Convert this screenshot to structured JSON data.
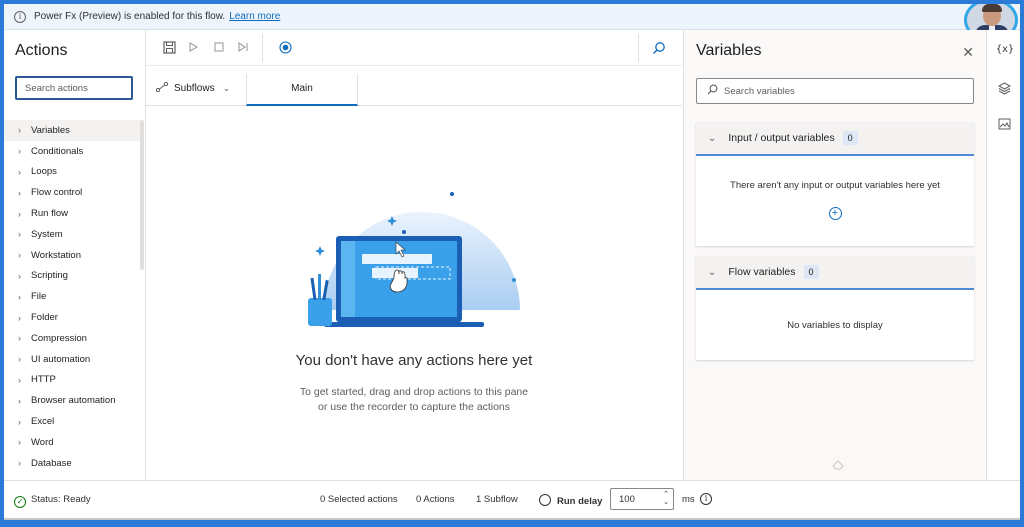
{
  "banner": {
    "text": "Power Fx (Preview) is enabled for this flow.",
    "link": "Learn more"
  },
  "actions_pane": {
    "title": "Actions",
    "search_placeholder": "Search actions",
    "items": [
      {
        "label": "Variables"
      },
      {
        "label": "Conditionals"
      },
      {
        "label": "Loops"
      },
      {
        "label": "Flow control"
      },
      {
        "label": "Run flow"
      },
      {
        "label": "System"
      },
      {
        "label": "Workstation"
      },
      {
        "label": "Scripting"
      },
      {
        "label": "File"
      },
      {
        "label": "Folder"
      },
      {
        "label": "Compression"
      },
      {
        "label": "UI automation"
      },
      {
        "label": "HTTP"
      },
      {
        "label": "Browser automation"
      },
      {
        "label": "Excel"
      },
      {
        "label": "Word"
      },
      {
        "label": "Database"
      }
    ]
  },
  "toolbar": {
    "icons": [
      "save-icon",
      "run-icon",
      "stop-icon",
      "next-step-icon",
      "record-icon",
      "find-icon"
    ]
  },
  "tabs": {
    "subflows_label": "Subflows",
    "main_label": "Main"
  },
  "canvas": {
    "empty_title": "You don't have any actions here yet",
    "empty_line1": "To get started, drag and drop actions to this pane",
    "empty_line2": "or use the recorder to capture the actions"
  },
  "variables_pane": {
    "title": "Variables",
    "search_placeholder": "Search variables",
    "io_section": {
      "title": "Input / output variables",
      "count": "0",
      "empty_text": "There aren't any input or output variables here yet"
    },
    "flow_section": {
      "title": "Flow variables",
      "count": "0",
      "empty_text": "No variables to display"
    }
  },
  "status_bar": {
    "status": "Status: Ready",
    "selected_actions": "0 Selected actions",
    "actions": "0 Actions",
    "subflow": "1 Subflow",
    "run_delay_label": "Run delay",
    "run_delay_value": "100",
    "unit": "ms"
  },
  "colors": {
    "accent": "#0f6cbd",
    "frame": "#2b7bd6",
    "ready": "#107c10"
  }
}
